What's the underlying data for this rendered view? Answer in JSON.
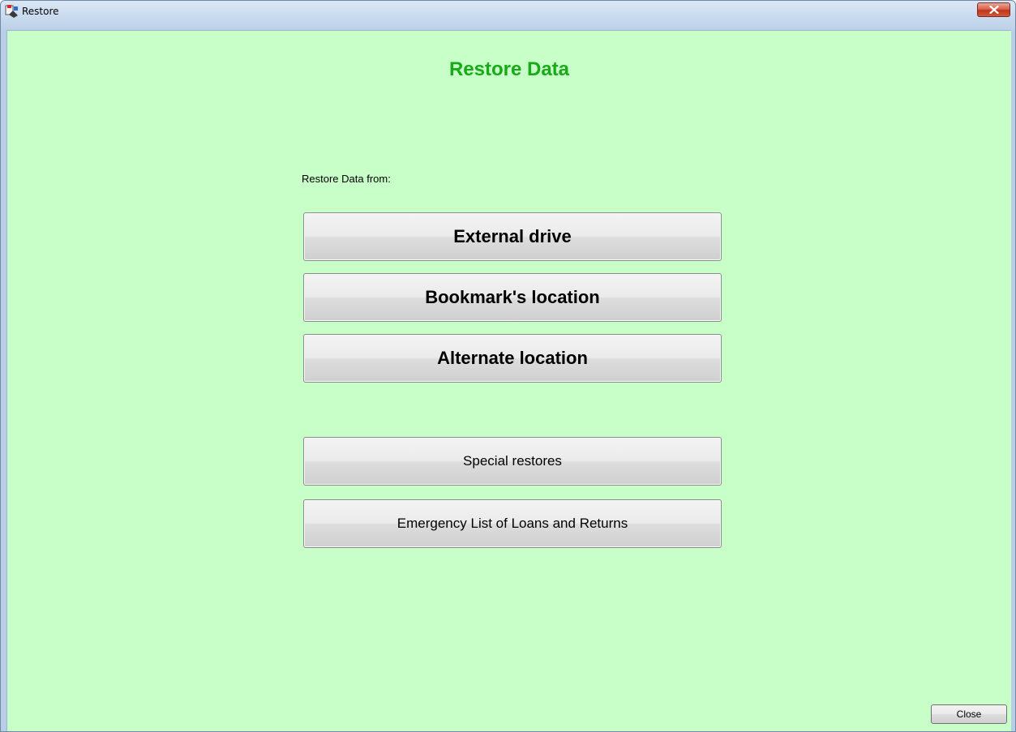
{
  "window": {
    "title": "Restore",
    "app_icon": "restore-app-icon",
    "close_icon": "close-x-icon"
  },
  "main": {
    "heading": "Restore Data",
    "prompt": "Restore Data from:",
    "primary_options": [
      {
        "label": "External drive"
      },
      {
        "label": "Bookmark's location"
      },
      {
        "label": "Alternate location"
      }
    ],
    "secondary_options": [
      {
        "label": "Special restores"
      },
      {
        "label": "Emergency List of Loans and Returns"
      }
    ]
  },
  "footer": {
    "close_label": "Close"
  },
  "colors": {
    "background": "#c8fec8",
    "heading": "#18aa18",
    "close_button": "#c1331b"
  }
}
